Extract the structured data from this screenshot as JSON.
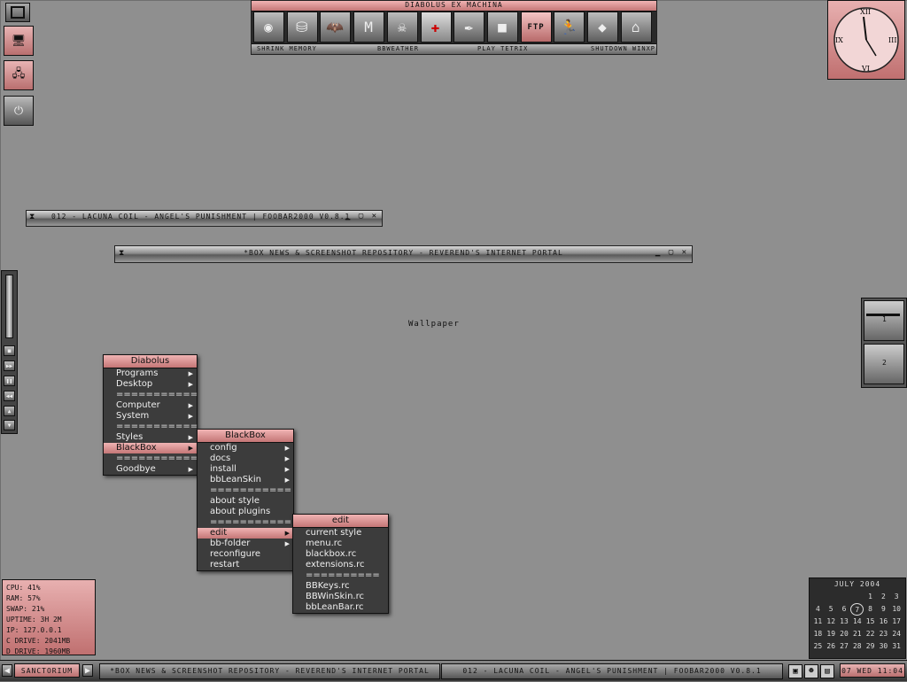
{
  "wallpaper": {
    "label": "Wallpaper"
  },
  "toolbar": {
    "title": "Diabolus Ex Machina",
    "labels": [
      "Shrink Memory",
      "BBWeather",
      "Play Tetrix",
      "Shutdown WinXP"
    ],
    "icons": [
      "disc-icon",
      "drive-icon",
      "bat-icon",
      "m-icon",
      "cat-icon",
      "medkit-icon",
      "pen-icon",
      "square-icon",
      "ftp-icon",
      "runner-icon",
      "folder-icon",
      "dd-icon"
    ],
    "ftp_label": "FTP"
  },
  "clock": {
    "numerals": {
      "xii": "XII",
      "iii": "III",
      "vi": "VI",
      "ix": "IX"
    }
  },
  "windows": {
    "foobar": "012 - Lacuna Coil - Angel's Punishment | foobar2000 v0.8.1",
    "box_news": "*Box News & Screenshot Repository - Reverend's Internet Portal"
  },
  "workspaces": [
    "1",
    "2"
  ],
  "menus": {
    "diabolus": {
      "title": "Diabolus",
      "items": [
        "Programs",
        "Desktop",
        "===========",
        "Computer",
        "System",
        "===========",
        "Styles",
        "BlackBox",
        "===========",
        "Goodbye"
      ]
    },
    "blackbox": {
      "title": "BlackBox",
      "items": [
        "config",
        "docs",
        "install",
        "bbLeanSkin",
        "===========",
        "about style",
        "about plugins",
        "===========",
        "edit",
        "bb-folder",
        "reconfigure",
        "restart"
      ]
    },
    "edit": {
      "title": "edit",
      "items": [
        "current style",
        "menu.rc",
        "blackbox.rc",
        "extensions.rc",
        "==========",
        "BBKeys.rc",
        "BBWinSkin.rc",
        "bbLeanBar.rc"
      ]
    }
  },
  "stats": [
    "CPU: 41%",
    "RAM: 57%",
    "SWAP: 21%",
    "UPTIME: 3H 2M",
    "IP: 127.0.0.1",
    "C DRIVE: 2041MB",
    "D DRIVE: 1960MB"
  ],
  "calendar": {
    "title": "JULY 2004",
    "rows": [
      [
        "",
        "",
        "",
        "",
        "1",
        "2",
        "3"
      ],
      [
        "4",
        "5",
        "6",
        "7",
        "8",
        "9",
        "10"
      ],
      [
        "11",
        "12",
        "13",
        "14",
        "15",
        "16",
        "17"
      ],
      [
        "18",
        "19",
        "20",
        "21",
        "22",
        "23",
        "24"
      ],
      [
        "25",
        "26",
        "27",
        "28",
        "29",
        "30",
        "31"
      ]
    ]
  },
  "taskbar": {
    "workspace": "SANCTORIUM",
    "tasks": [
      "*Box News & Screenshot Repository - Reverend's Internet Portal",
      "012 - Lacuna Coil - Angel's Punishment | foobar2000 v0.8.1"
    ],
    "clock": "07 WED 11:04"
  }
}
